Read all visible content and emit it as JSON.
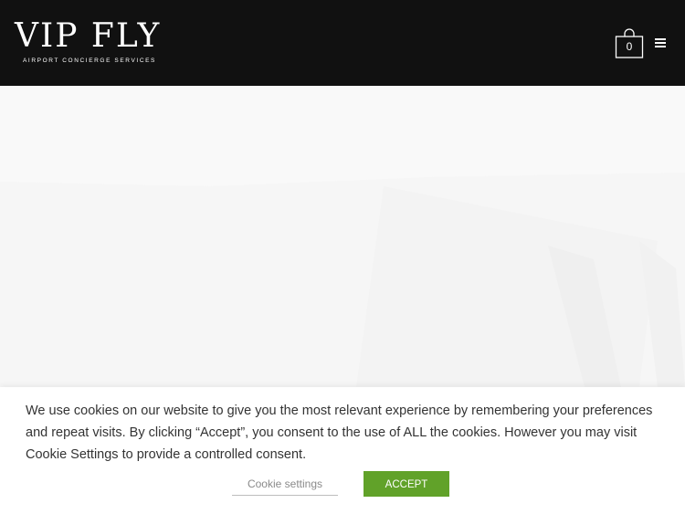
{
  "header": {
    "logo_text": "VIP FLY",
    "logo_tagline": "AIRPORT CONCIERGE SERVICES",
    "cart_count": "0",
    "cart_icon": "shopping-bag-icon",
    "menu_icon": "hamburger-menu-icon"
  },
  "cookie_banner": {
    "message": "We use cookies on our website to give you the most relevant experience by remembering your preferences and repeat visits. By clicking “Accept”, you consent to the use of ALL the cookies. However you may visit Cookie Settings to provide a controlled consent.",
    "settings_label": "Cookie settings",
    "accept_label": "ACCEPT"
  },
  "colors": {
    "header_bg": "#111111",
    "accept_button": "#61a229"
  }
}
